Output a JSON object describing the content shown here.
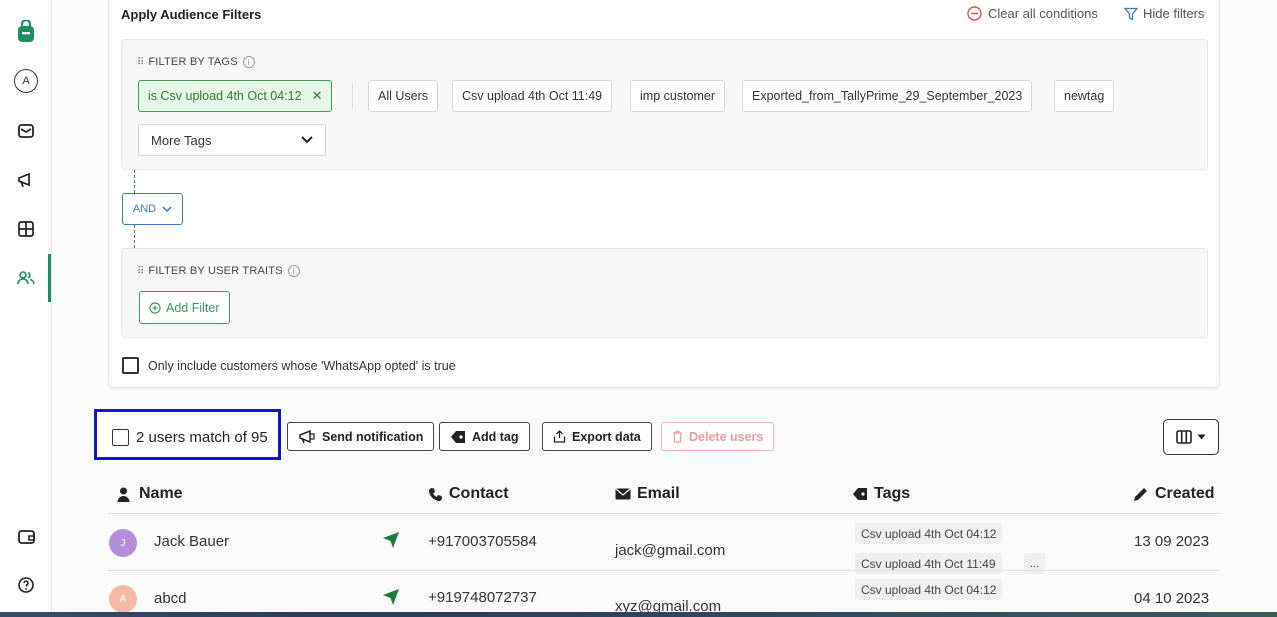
{
  "sidebar": {
    "items": [
      {
        "name": "brand-logo",
        "label": ""
      },
      {
        "name": "account-avatar",
        "label": "A"
      },
      {
        "name": "inbox",
        "label": ""
      },
      {
        "name": "campaigns",
        "label": ""
      },
      {
        "name": "apps",
        "label": ""
      },
      {
        "name": "audience",
        "label": ""
      },
      {
        "name": "wallet",
        "label": ""
      },
      {
        "name": "help",
        "label": ""
      }
    ],
    "active": "audience"
  },
  "filters": {
    "title": "Apply Audience Filters",
    "clear_all": "Clear all conditions",
    "hide_filters": "Hide filters",
    "tags_box": {
      "label": "FILTER BY TAGS",
      "selected_tag": "is Csv upload 4th Oct 04:12",
      "tags": [
        "All Users",
        "Csv upload 4th Oct 11:49",
        "imp customer",
        "Exported_from_TallyPrime_29_September_2023",
        "newtag"
      ],
      "more_tags": "More Tags"
    },
    "operator": "AND",
    "traits_box": {
      "label": "FILTER BY USER TRAITS",
      "add_filter": "Add Filter"
    },
    "whatsapp_opted": "Only include customers whose 'WhatsApp opted' is true"
  },
  "actions": {
    "match_text": "2 users match of 95",
    "send_notification": "Send notification",
    "add_tag": "Add tag",
    "export_data": "Export data",
    "delete_users": "Delete users"
  },
  "table": {
    "columns": {
      "name": "Name",
      "contact": "Contact",
      "email": "Email",
      "tags": "Tags",
      "created": "Created"
    },
    "rows": [
      {
        "initial": "J",
        "name": "Jack Bauer",
        "contact": "+917003705584",
        "email": "jack@gmail.com",
        "tags": [
          "Csv upload 4th Oct 04:12",
          "Csv upload 4th Oct 11:49"
        ],
        "more": "...",
        "created": "13 09 2023"
      },
      {
        "initial": "A",
        "name": "abcd",
        "contact": "+919748072737",
        "email": "xyz@gmail.com",
        "tags": [
          "Csv upload 4th Oct 04:12"
        ],
        "created": "04 10 2023"
      }
    ]
  },
  "colors": {
    "brand_green": "#1f8f5f",
    "highlight_box": "#1414cc",
    "link_blue": "#3b78c2",
    "danger": "#e57373"
  }
}
